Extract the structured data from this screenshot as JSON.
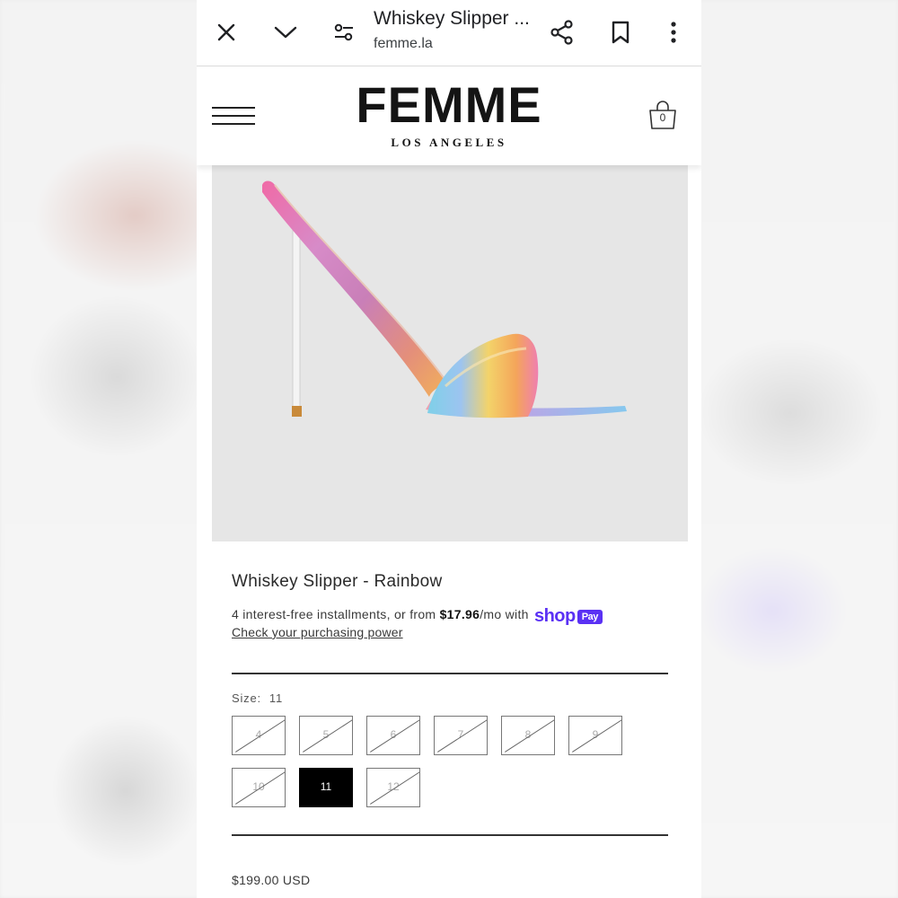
{
  "browser": {
    "title": "Whiskey Slipper ...",
    "url": "femme.la"
  },
  "icons": {
    "close": "close-icon",
    "collapse": "chevron-down-icon",
    "site_settings": "tune-icon",
    "share": "share-icon",
    "bookmark": "bookmark-icon",
    "more": "more-vert-icon",
    "menu": "hamburger-icon",
    "cart": "shopping-bag-icon"
  },
  "header": {
    "brand": "FEMME",
    "brand_sub": "LOS ANGELES",
    "cart_count": "0"
  },
  "product": {
    "title": "Whiskey Slipper - Rainbow",
    "installments_prefix": "4 interest-free installments, or from ",
    "installment_amount": "$17.96",
    "installments_suffix": "/mo with",
    "shop_label": "shop",
    "pay_label": "Pay",
    "check_link": "Check your purchasing power",
    "size_label": "Size:",
    "selected_size": "11",
    "sizes": [
      {
        "label": "4",
        "available": false
      },
      {
        "label": "5",
        "available": false
      },
      {
        "label": "6",
        "available": false
      },
      {
        "label": "7",
        "available": false
      },
      {
        "label": "8",
        "available": false
      },
      {
        "label": "9",
        "available": false
      },
      {
        "label": "10",
        "available": false
      },
      {
        "label": "11",
        "available": true,
        "selected": true
      },
      {
        "label": "12",
        "available": false
      }
    ],
    "price": "$199.00 USD"
  },
  "colors": {
    "shop_pay": "#5a31f4",
    "selected_size_bg": "#000000"
  }
}
